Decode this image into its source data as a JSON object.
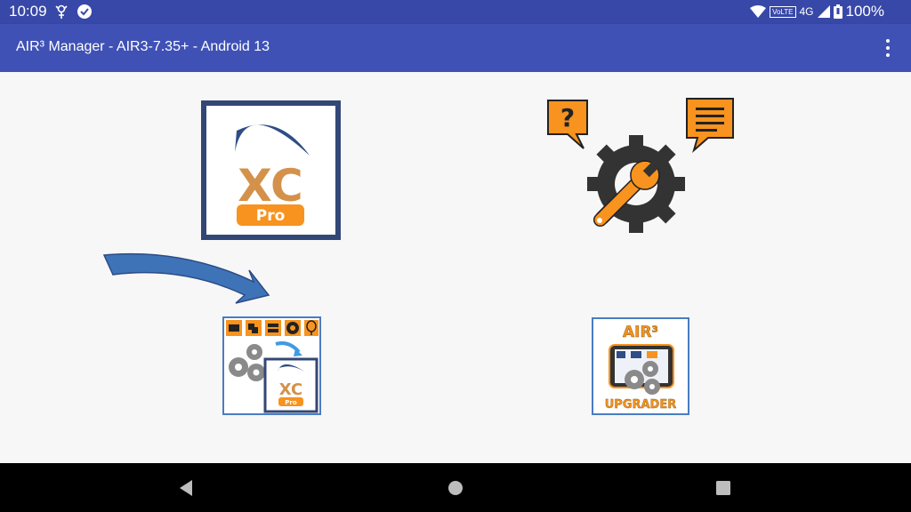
{
  "status_bar": {
    "time": "10:09",
    "volte": "VoLTE",
    "network": "4G",
    "battery": "100%"
  },
  "app_bar": {
    "title": "AIR³ Manager - AIR3-7.35+ - Android 13"
  },
  "tiles": {
    "xcpro_logo": {
      "main_text": "XC",
      "badge_text": "Pro"
    },
    "install_tile": {
      "main_text": "XC",
      "badge_text": "Pro"
    },
    "upgrader_tile": {
      "brand": "AIR³",
      "label": "UPGRADER"
    }
  },
  "colors": {
    "status_bar": "#3848a8",
    "app_bar": "#3f51b5",
    "accent_orange": "#f7931e",
    "frame_navy": "#334777",
    "arrow_blue": "#3f73b8"
  },
  "icons": {
    "support": [
      "question-bubble-icon",
      "gear-wrench-icon",
      "message-bubble-icon"
    ],
    "nav": [
      "back-icon",
      "home-icon",
      "recents-icon"
    ]
  }
}
